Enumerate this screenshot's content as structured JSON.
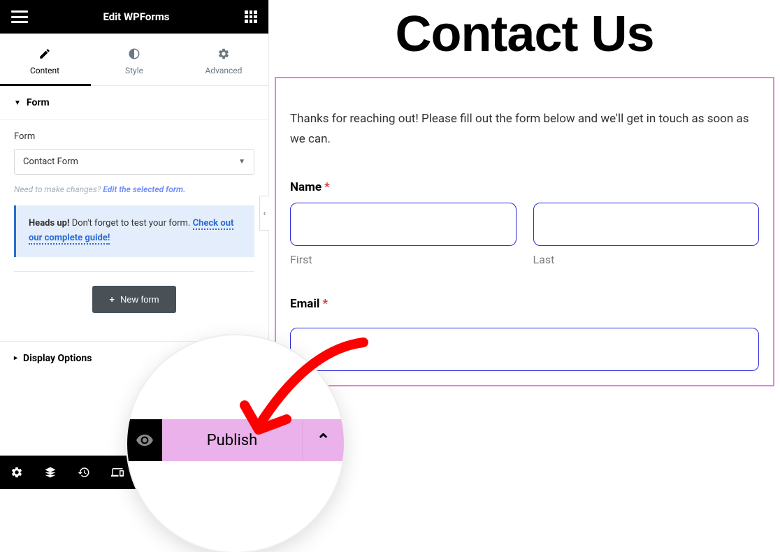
{
  "header": {
    "title": "Edit WPForms"
  },
  "tabs": {
    "content": "Content",
    "style": "Style",
    "advanced": "Advanced"
  },
  "section_form": {
    "title": "Form",
    "label": "Form",
    "selected": "Contact Form",
    "helper_prefix": "Need to make changes? ",
    "helper_link": "Edit the selected form.",
    "info_strong": "Heads up!",
    "info_text": " Don't forget to test your form. ",
    "info_link": "Check out our complete guide!",
    "new_form_btn": "New form"
  },
  "section_display": {
    "title": "Display Options"
  },
  "publish": {
    "label": "Publish"
  },
  "canvas": {
    "page_title": "Contact Us",
    "intro": "Thanks for reaching out! Please fill out the form below and we'll get in touch as soon as we can.",
    "name_label": "Name",
    "first_label": "First",
    "last_label": "Last",
    "email_label": "Email"
  }
}
